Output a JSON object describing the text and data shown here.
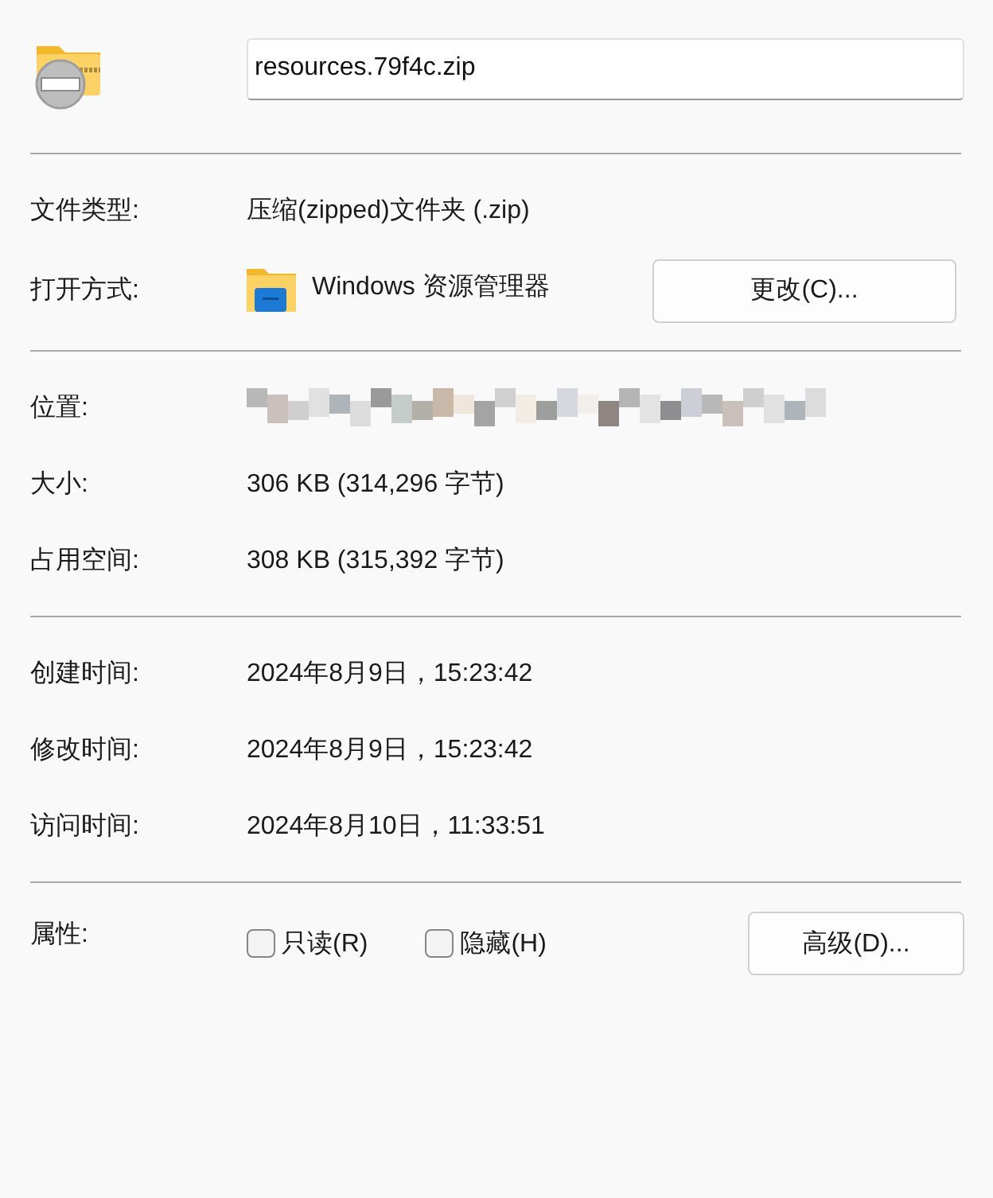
{
  "header": {
    "file_name": "resources.79f4c.zip"
  },
  "sections": [
    [
      {
        "kind": "text",
        "label": "文件类型:",
        "value": "压缩(zipped)文件夹 (.zip)"
      },
      {
        "kind": "app",
        "label": "打开方式:",
        "value": "Windows 资源管理器",
        "button": "更改(C)..."
      }
    ],
    [
      {
        "kind": "redacted",
        "label": "位置:"
      },
      {
        "kind": "text",
        "label": "大小:",
        "value": "306 KB (314,296 字节)"
      },
      {
        "kind": "text",
        "label": "占用空间:",
        "value": "308 KB (315,392 字节)"
      }
    ],
    [
      {
        "kind": "text",
        "label": "创建时间:",
        "value": "2024年8月9日，15:23:42"
      },
      {
        "kind": "text",
        "label": "修改时间:",
        "value": "2024年8月9日，15:23:42"
      },
      {
        "kind": "text",
        "label": "访问时间:",
        "value": "2024年8月10日，11:33:51"
      }
    ],
    [
      {
        "kind": "attributes",
        "label": "属性:",
        "checkboxes": [
          {
            "label": "只读(R)",
            "checked": false
          },
          {
            "label": "隐藏(H)",
            "checked": false
          }
        ],
        "button": "高级(D)..."
      }
    ]
  ]
}
